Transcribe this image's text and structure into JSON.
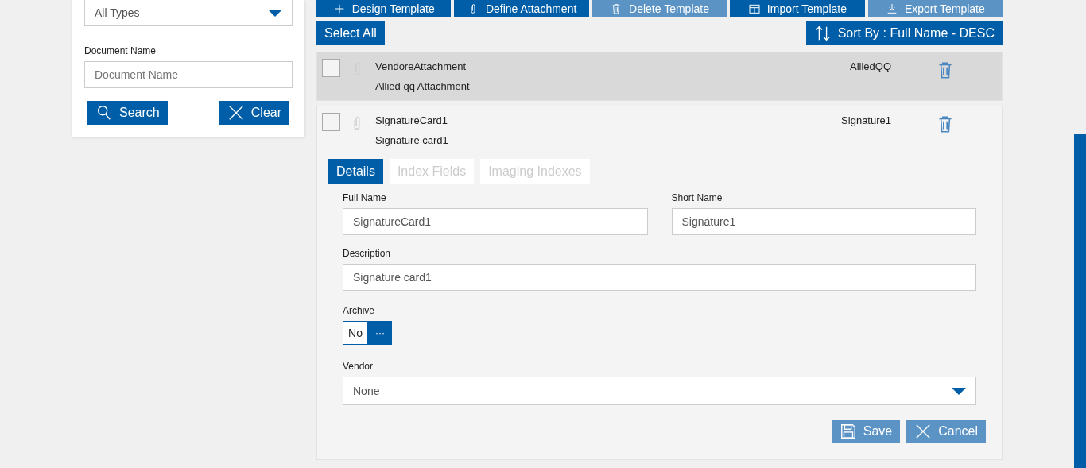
{
  "filter_panel": {
    "type_select": {
      "value": "All Types"
    },
    "document_name": {
      "label": "Document Name",
      "placeholder": "Document Name"
    },
    "buttons": [
      {
        "kind": "search",
        "label": "Search"
      },
      {
        "kind": "clear",
        "label": "Clear"
      }
    ]
  },
  "toolbar": [
    {
      "kind": "plus",
      "label": "Design Template",
      "disabled": false
    },
    {
      "kind": "clip",
      "label": "Define Attachment",
      "disabled": false
    },
    {
      "kind": "trash",
      "label": "Delete Template",
      "disabled": true
    },
    {
      "kind": "import",
      "label": "Import Template",
      "disabled": false
    },
    {
      "kind": "export",
      "label": "Export Template",
      "disabled": true
    }
  ],
  "select_all": "Select All",
  "sort": {
    "label": "Sort By : Full Name - DESC"
  },
  "templates": [
    {
      "name": "VendoreAttachment",
      "description": "Allied qq Attachment",
      "short_name": "AlliedQQ",
      "checked": false,
      "selected": true,
      "expanded": false
    },
    {
      "name": "SignatureCard1",
      "description": "Signature card1",
      "short_name": "Signature1",
      "checked": false,
      "selected": false,
      "expanded": true
    }
  ],
  "details": {
    "tabs": [
      {
        "label": "Details",
        "selected": true
      },
      {
        "label": "Index Fields",
        "selected": false
      },
      {
        "label": "Imaging Indexes",
        "selected": false
      }
    ],
    "full_name": {
      "label": "Full Name",
      "value": "SignatureCard1"
    },
    "short_name": {
      "label": "Short Name",
      "value": "Signature1"
    },
    "description": {
      "label": "Description",
      "value": "Signature card1"
    },
    "archive": {
      "label": "Archive",
      "value": "No",
      "more": "···"
    },
    "vendor": {
      "label": "Vendor",
      "value": "None"
    },
    "buttons": [
      {
        "kind": "save",
        "label": "Save",
        "disabled": true
      },
      {
        "kind": "cancel",
        "label": "Cancel",
        "disabled": true
      }
    ]
  }
}
